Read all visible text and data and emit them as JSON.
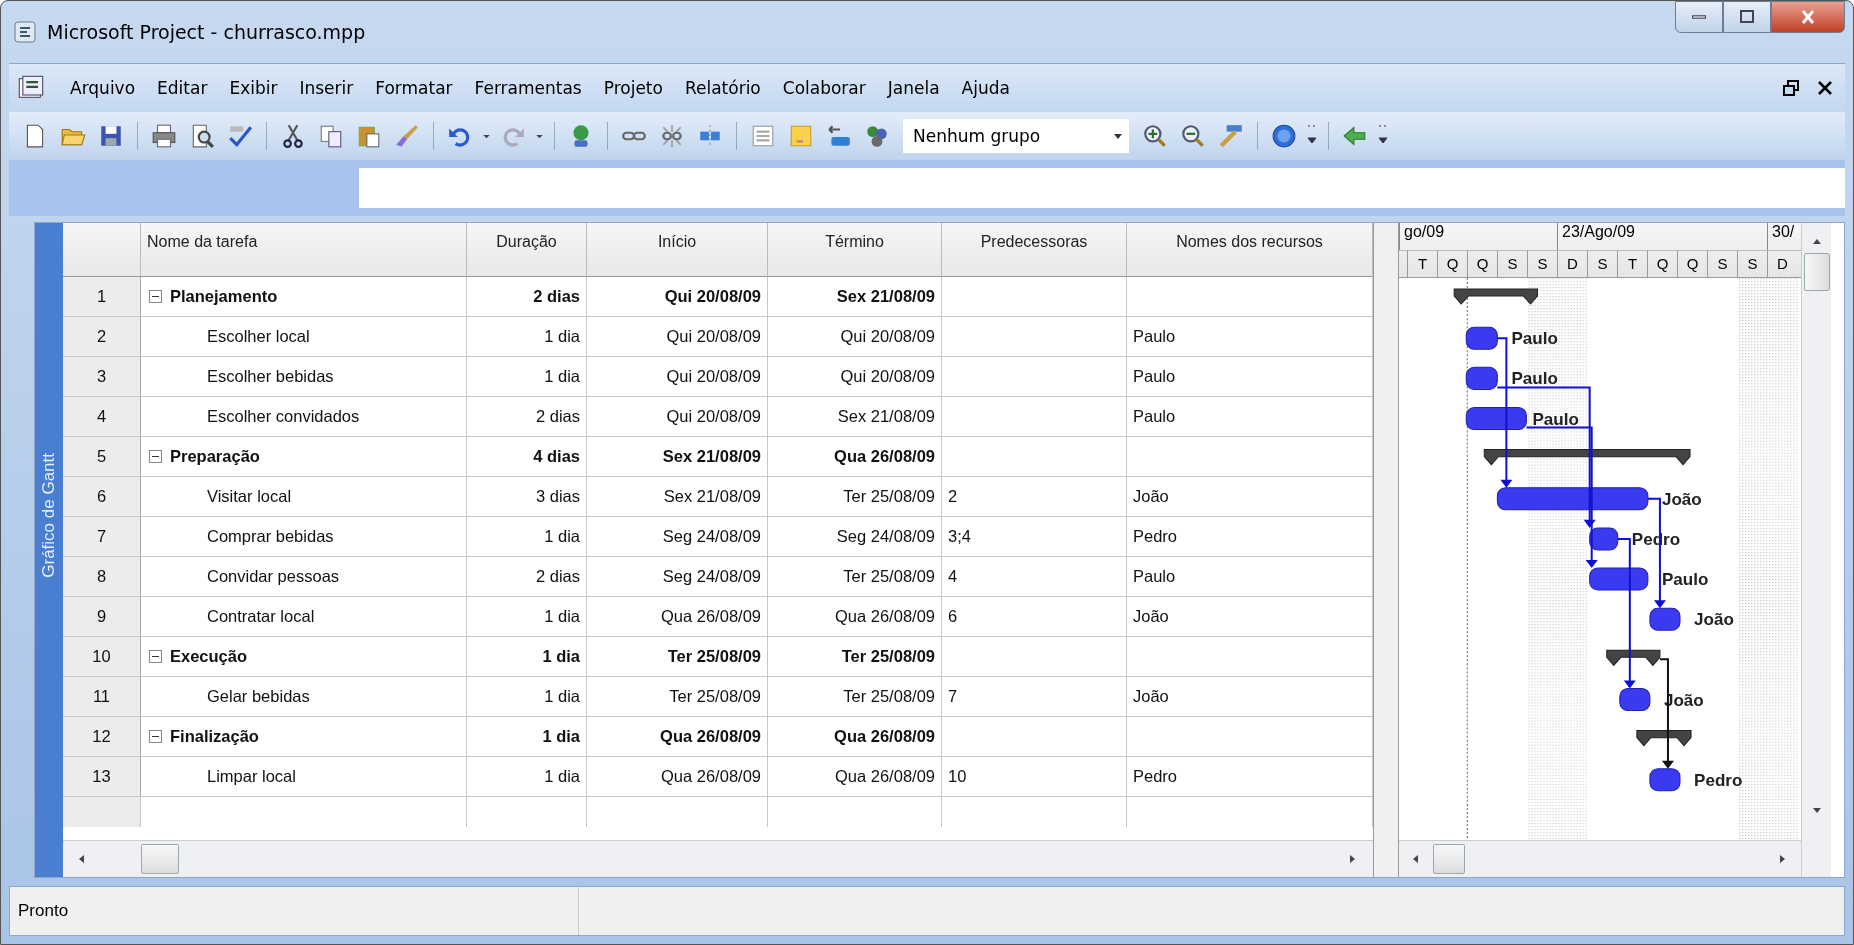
{
  "window": {
    "title": "Microsoft Project - churrasco.mpp"
  },
  "menu": [
    "Arquivo",
    "Editar",
    "Exibir",
    "Inserir",
    "Formatar",
    "Ferramentas",
    "Projeto",
    "Relatório",
    "Colaborar",
    "Janela",
    "Ajuda"
  ],
  "toolbar": {
    "group_dropdown": "Nenhum grupo"
  },
  "side_tab": "Gráfico de Gantt",
  "table": {
    "columns": [
      "Nome da tarefa",
      "Duração",
      "Início",
      "Término",
      "Predecessoras",
      "Nomes dos recursos"
    ],
    "tasks": [
      {
        "id": "1",
        "name": "Planejamento",
        "duration": "2 dias",
        "start": "Qui 20/08/09",
        "finish": "Sex 21/08/09",
        "expanded": true,
        "children": [
          {
            "id": "2",
            "name": "Escolher local",
            "duration": "1 dia",
            "start": "Qui 20/08/09",
            "finish": "Qui 20/08/09",
            "resources": "Paulo"
          },
          {
            "id": "3",
            "name": "Escolher bebidas",
            "duration": "1 dia",
            "start": "Qui 20/08/09",
            "finish": "Qui 20/08/09",
            "resources": "Paulo"
          },
          {
            "id": "4",
            "name": "Escolher convidados",
            "duration": "2 dias",
            "start": "Qui 20/08/09",
            "finish": "Sex 21/08/09",
            "resources": "Paulo"
          }
        ]
      },
      {
        "id": "5",
        "name": "Preparação",
        "duration": "4 dias",
        "start": "Sex 21/08/09",
        "finish": "Qua 26/08/09",
        "expanded": true,
        "children": [
          {
            "id": "6",
            "name": "Visitar local",
            "duration": "3 dias",
            "start": "Sex 21/08/09",
            "finish": "Ter 25/08/09",
            "predecessors": "2",
            "resources": "João"
          },
          {
            "id": "7",
            "name": "Comprar bebidas",
            "duration": "1 dia",
            "start": "Seg 24/08/09",
            "finish": "Seg 24/08/09",
            "predecessors": "3;4",
            "resources": "Pedro"
          },
          {
            "id": "8",
            "name": "Convidar pessoas",
            "duration": "2 dias",
            "start": "Seg 24/08/09",
            "finish": "Ter 25/08/09",
            "predecessors": "4",
            "resources": "Paulo"
          },
          {
            "id": "9",
            "name": "Contratar local",
            "duration": "1 dia",
            "start": "Qua 26/08/09",
            "finish": "Qua 26/08/09",
            "predecessors": "6",
            "resources": "João"
          }
        ]
      },
      {
        "id": "10",
        "name": "Execução",
        "duration": "1 dia",
        "start": "Ter 25/08/09",
        "finish": "Ter 25/08/09",
        "expanded": true,
        "children": [
          {
            "id": "11",
            "name": "Gelar bebidas",
            "duration": "1 dia",
            "start": "Ter 25/08/09",
            "finish": "Ter 25/08/09",
            "predecessors": "7",
            "resources": "João"
          }
        ]
      },
      {
        "id": "12",
        "name": "Finalização",
        "duration": "1 dia",
        "start": "Qua 26/08/09",
        "finish": "Qua 26/08/09",
        "expanded": true,
        "children": [
          {
            "id": "13",
            "name": "Limpar local",
            "duration": "1 dia",
            "start": "Qua 26/08/09",
            "finish": "Qua 26/08/09",
            "predecessors": "10",
            "resources": "Pedro"
          }
        ]
      }
    ]
  },
  "gantt": {
    "timescale_top": [
      "go/09",
      "23/Ago/09",
      "30/"
    ],
    "days": [
      "T",
      "Q",
      "Q",
      "S",
      "S",
      "D",
      "S",
      "T",
      "Q",
      "Q",
      "S",
      "S",
      "D"
    ],
    "bar_labels": [
      "Paulo",
      "Paulo",
      "Paulo",
      "João",
      "Pedro",
      "Paulo",
      "João",
      "João",
      "Pedro"
    ]
  },
  "status_bar": "Pronto"
}
